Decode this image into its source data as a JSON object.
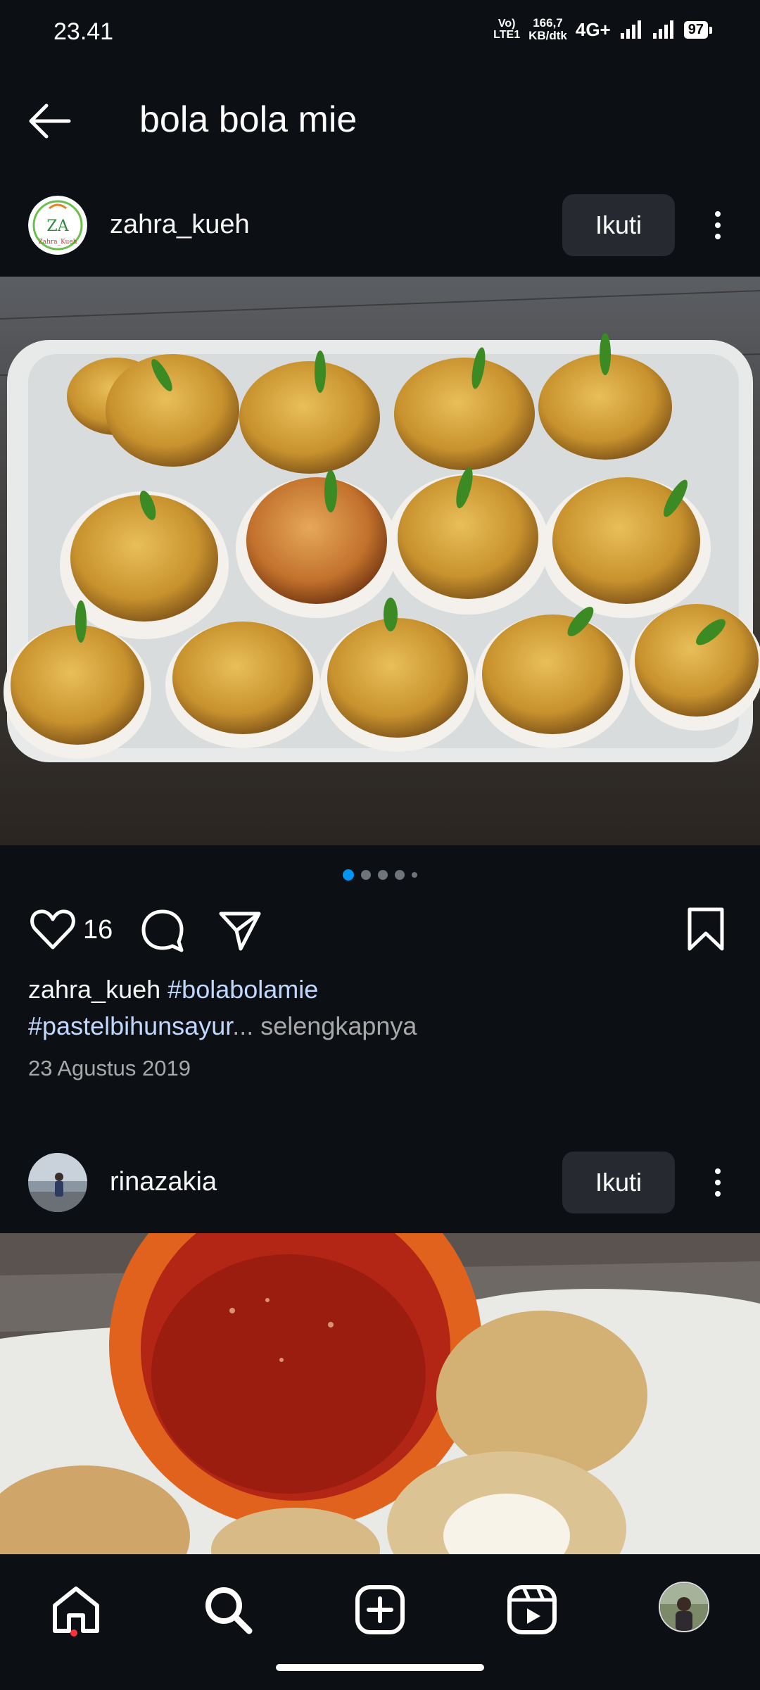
{
  "status_bar": {
    "time": "23.41",
    "volte": "Vo)",
    "lte": "LTE1",
    "net_speed_value": "166,7",
    "net_speed_unit": "KB/dtk",
    "network": "4G+",
    "battery": "97"
  },
  "header": {
    "title": "bola bola mie",
    "back_icon": "arrow-left-icon"
  },
  "posts": [
    {
      "username": "zahra_kueh",
      "avatar_logo_text": "ZA",
      "avatar_logo_subtext": "Zahra_Kueh",
      "follow_label": "Ikuti",
      "carousel": {
        "count": 5,
        "active_index": 0
      },
      "likes": "16",
      "caption_user": "zahra_kueh",
      "caption_hashtag_1": "#bolabolamie",
      "caption_hashtag_2": "#pastelbihunsayur",
      "caption_ellipsis": "...",
      "caption_more": "selengkapnya",
      "date": "23 Agustus 2019"
    },
    {
      "username": "rinazakia",
      "follow_label": "Ikuti"
    }
  ],
  "bottom_nav": {
    "items": [
      "home-icon",
      "search-icon",
      "create-icon",
      "reels-icon",
      "profile-avatar"
    ]
  },
  "colors": {
    "background": "#0c1014",
    "follow_button_bg": "#262a30",
    "hashtag": "#c0d7ff",
    "carousel_active": "#0095f6",
    "notification_dot": "#ff3040"
  }
}
